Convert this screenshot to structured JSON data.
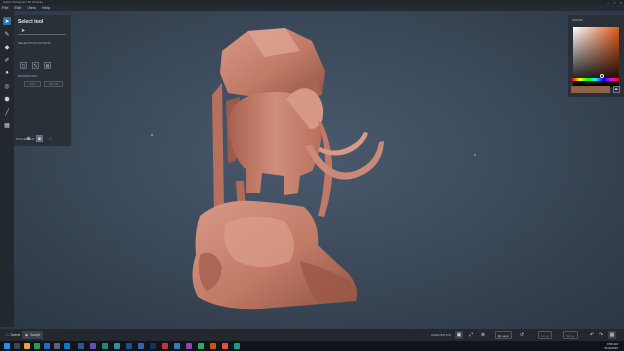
{
  "window": {
    "title": "Adobe Substance 3D Modeler"
  },
  "menu": [
    "File",
    "Edit",
    "View",
    "Help"
  ],
  "tool_panel": {
    "title": "Select tool",
    "selection_actions_label": "SELECTION ACTIONS",
    "selection_actions": [
      "select-icon",
      "transform-icon",
      "duplicate-icon"
    ],
    "groupings_label": "GROUPINGS",
    "groupings": [
      "Join",
      "Blends"
    ],
    "placement_label": "PLACEMENT"
  },
  "color_panel": {
    "title": "COLOR",
    "current_color": "#8e6148",
    "hue_color": "#e05a1a"
  },
  "bottom_bar": {
    "tabs": [
      {
        "label": "Scene",
        "icon": "scene-icon",
        "active": false
      },
      {
        "label": "Sculpt",
        "icon": "sculpt-icon",
        "active": true
      }
    ],
    "orientation_label": "ORIENTATION",
    "layer_label": "Layer",
    "buttons": [
      "Group",
      "Merge"
    ]
  },
  "taskbar": {
    "time": "9:56 AM",
    "date": "8/16/2023"
  },
  "colors": {
    "accent": "#2d6fb0",
    "model": "#c9826f",
    "viewport_bg": "#3e4b5c"
  }
}
